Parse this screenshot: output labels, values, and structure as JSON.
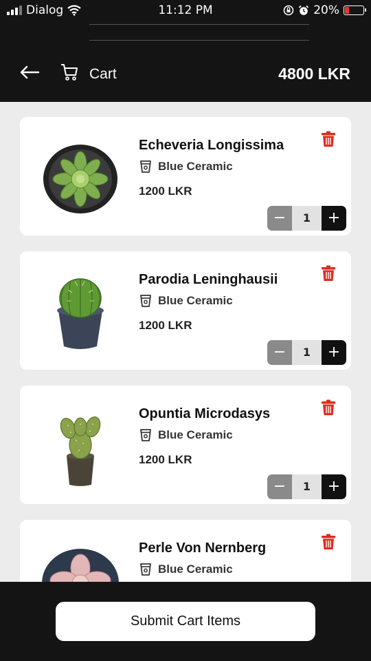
{
  "status_bar": {
    "carrier": "Dialog",
    "time": "11:12 PM",
    "battery": "20%",
    "battery_level": 0.2
  },
  "header": {
    "title": "Cart",
    "total": "4800 LKR"
  },
  "items": [
    {
      "name": "Echeveria Longissima",
      "pot": "Blue Ceramic",
      "price": "1200 LKR",
      "qty": "1",
      "image_icon": "succulent-rosette"
    },
    {
      "name": "Parodia Leninghausii",
      "pot": "Blue Ceramic",
      "price": "1200 LKR",
      "qty": "1",
      "image_icon": "cactus-round"
    },
    {
      "name": "Opuntia Microdasys",
      "pot": "Blue Ceramic",
      "price": "1200 LKR",
      "qty": "1",
      "image_icon": "cactus-paddle"
    },
    {
      "name": "Perle Von Nernberg",
      "pot": "Blue Ceramic",
      "price": "",
      "qty": "",
      "image_icon": "succulent-pink"
    }
  ],
  "stepper": {
    "minus": "−",
    "plus": "+"
  },
  "footer": {
    "submit_label": "Submit Cart Items"
  },
  "colors": {
    "accent": "#141414",
    "delete": "#e02b20",
    "background": "#ececec"
  }
}
